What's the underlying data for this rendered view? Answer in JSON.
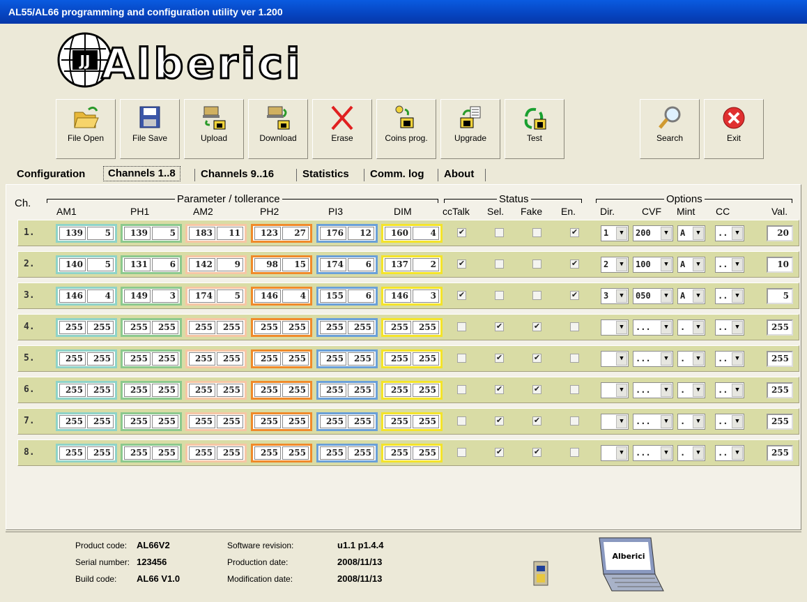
{
  "window": {
    "title": "AL55/AL66 programming and configuration utility ver 1.200"
  },
  "logo": {
    "text": "Alberici"
  },
  "toolbar": [
    {
      "label": "File Open",
      "icon": "folder-open-icon"
    },
    {
      "label": "File Save",
      "icon": "floppy-disk-icon"
    },
    {
      "label": "Upload",
      "icon": "upload-icon"
    },
    {
      "label": "Download",
      "icon": "download-icon"
    },
    {
      "label": "Erase",
      "icon": "erase-x-icon"
    },
    {
      "label": "Coins prog.",
      "icon": "coins-prog-icon"
    },
    {
      "label": "Upgrade",
      "icon": "upgrade-icon"
    },
    {
      "label": "Test",
      "icon": "test-recycle-icon"
    },
    {
      "label": "Search",
      "icon": "magnifier-icon"
    },
    {
      "label": "Exit",
      "icon": "exit-icon"
    }
  ],
  "tabs": [
    {
      "label": "Configuration",
      "selected": false
    },
    {
      "label": "Channels 1..8",
      "selected": true
    },
    {
      "label": "Channels 9..16",
      "selected": false
    },
    {
      "label": "Statistics",
      "selected": false
    },
    {
      "label": "Comm. log",
      "selected": false
    },
    {
      "label": "About",
      "selected": false
    }
  ],
  "headers": {
    "ch": "Ch.",
    "param_group": "Parameter / tollerance",
    "params": [
      "AM1",
      "PH1",
      "AM2",
      "PH2",
      "PI3",
      "DIM"
    ],
    "status_group": "Status",
    "status": [
      "ccTalk",
      "Sel.",
      "Fake",
      "En."
    ],
    "options_group": "Options",
    "options": [
      "Dir.",
      "CVF",
      "Mint",
      "CC"
    ],
    "val": "Val."
  },
  "group_colors": [
    "#8fd3c8",
    "#8cc98e",
    "#f6c6a5",
    "#f08a2a",
    "#6aa0d8",
    "#f4e42a"
  ],
  "channels": [
    {
      "num": "1.",
      "params": [
        [
          "139",
          "5"
        ],
        [
          "139",
          "5"
        ],
        [
          "183",
          "11"
        ],
        [
          "123",
          "27"
        ],
        [
          "176",
          "12"
        ],
        [
          "160",
          "4"
        ]
      ],
      "cctalk": true,
      "sel": false,
      "fake": false,
      "en": true,
      "dir": "1",
      "cvf": "200",
      "mint": "A",
      "cc": "..",
      "val": "20"
    },
    {
      "num": "2.",
      "params": [
        [
          "140",
          "5"
        ],
        [
          "131",
          "6"
        ],
        [
          "142",
          "9"
        ],
        [
          "98",
          "15"
        ],
        [
          "174",
          "6"
        ],
        [
          "137",
          "2"
        ]
      ],
      "cctalk": true,
      "sel": false,
      "fake": false,
      "en": true,
      "dir": "2",
      "cvf": "100",
      "mint": "A",
      "cc": "..",
      "val": "10"
    },
    {
      "num": "3.",
      "params": [
        [
          "146",
          "4"
        ],
        [
          "149",
          "3"
        ],
        [
          "174",
          "5"
        ],
        [
          "146",
          "4"
        ],
        [
          "155",
          "6"
        ],
        [
          "146",
          "3"
        ]
      ],
      "cctalk": true,
      "sel": false,
      "fake": false,
      "en": true,
      "dir": "3",
      "cvf": "050",
      "mint": "A",
      "cc": "..",
      "val": "5"
    },
    {
      "num": "4.",
      "params": [
        [
          "255",
          "255"
        ],
        [
          "255",
          "255"
        ],
        [
          "255",
          "255"
        ],
        [
          "255",
          "255"
        ],
        [
          "255",
          "255"
        ],
        [
          "255",
          "255"
        ]
      ],
      "cctalk": false,
      "sel": true,
      "fake": true,
      "en": false,
      "dir": "",
      "cvf": "...",
      "mint": ".",
      "cc": "..",
      "val": "255"
    },
    {
      "num": "5.",
      "params": [
        [
          "255",
          "255"
        ],
        [
          "255",
          "255"
        ],
        [
          "255",
          "255"
        ],
        [
          "255",
          "255"
        ],
        [
          "255",
          "255"
        ],
        [
          "255",
          "255"
        ]
      ],
      "cctalk": false,
      "sel": true,
      "fake": true,
      "en": false,
      "dir": "",
      "cvf": "...",
      "mint": ".",
      "cc": "..",
      "val": "255"
    },
    {
      "num": "6.",
      "params": [
        [
          "255",
          "255"
        ],
        [
          "255",
          "255"
        ],
        [
          "255",
          "255"
        ],
        [
          "255",
          "255"
        ],
        [
          "255",
          "255"
        ],
        [
          "255",
          "255"
        ]
      ],
      "cctalk": false,
      "sel": true,
      "fake": true,
      "en": false,
      "dir": "",
      "cvf": "...",
      "mint": ".",
      "cc": "..",
      "val": "255"
    },
    {
      "num": "7.",
      "params": [
        [
          "255",
          "255"
        ],
        [
          "255",
          "255"
        ],
        [
          "255",
          "255"
        ],
        [
          "255",
          "255"
        ],
        [
          "255",
          "255"
        ],
        [
          "255",
          "255"
        ]
      ],
      "cctalk": false,
      "sel": true,
      "fake": true,
      "en": false,
      "dir": "",
      "cvf": "...",
      "mint": ".",
      "cc": "..",
      "val": "255"
    },
    {
      "num": "8.",
      "params": [
        [
          "255",
          "255"
        ],
        [
          "255",
          "255"
        ],
        [
          "255",
          "255"
        ],
        [
          "255",
          "255"
        ],
        [
          "255",
          "255"
        ],
        [
          "255",
          "255"
        ]
      ],
      "cctalk": false,
      "sel": true,
      "fake": true,
      "en": false,
      "dir": "",
      "cvf": "...",
      "mint": ".",
      "cc": "..",
      "val": "255"
    }
  ],
  "statusbar": {
    "product_code_label": "Product code:",
    "product_code": "AL66V2",
    "serial_label": "Serial number:",
    "serial": "123456",
    "build_label": "Build code:",
    "build": "AL66 V1.0",
    "sw_rev_label": "Software revision:",
    "sw_rev": "u1.1 p1.4.4",
    "prod_date_label": "Production date:",
    "prod_date": "2008/11/13",
    "mod_date_label": "Modification date:",
    "mod_date": "2008/11/13",
    "laptop_brand": "Alberici"
  }
}
